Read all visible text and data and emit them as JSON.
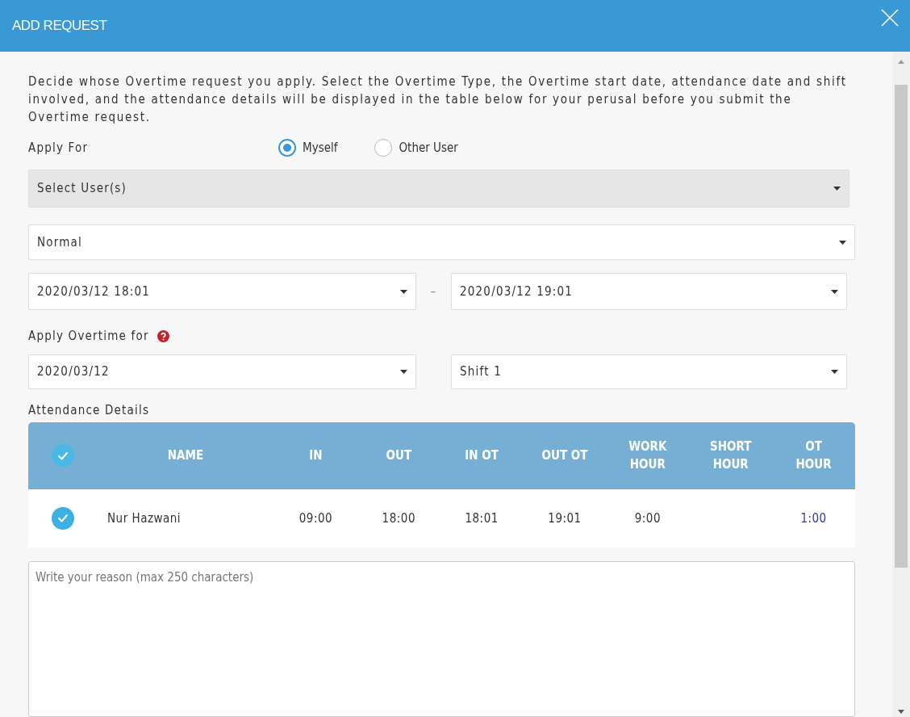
{
  "dialog": {
    "title": "ADD REQUEST"
  },
  "description": "Decide whose Overtime request you apply. Select the Overtime Type, the Overtime start date, attendance date and shift involved, and the attendance details will be displayed in the table below for your perusal before you submit the Overtime request.",
  "apply_for": {
    "label": "Apply For",
    "options": [
      {
        "label": "Myself",
        "selected": true
      },
      {
        "label": "Other User",
        "selected": false
      }
    ]
  },
  "user_select": {
    "placeholder": "Select User(s)",
    "disabled": true
  },
  "overtime_type": {
    "value": "Normal"
  },
  "date_range": {
    "start": "2020/03/12 18:01",
    "separator": "–",
    "end": "2020/03/12 19:01"
  },
  "apply_overtime_for": {
    "label": "Apply Overtime for",
    "attendance_date": "2020/03/12",
    "shift": "Shift 1"
  },
  "attendance": {
    "label": "Attendance Details",
    "all_checked": true,
    "columns": [
      "NAME",
      "IN",
      "OUT",
      "IN OT",
      "OUT OT",
      "WORK HOUR",
      "SHORT HOUR",
      "OT HOUR"
    ],
    "rows": [
      {
        "checked": true,
        "cells": [
          "Nur Hazwani",
          "09:00",
          "18:00",
          "18:01",
          "19:01",
          "9:00",
          "",
          "1:00"
        ]
      }
    ]
  },
  "reason": {
    "placeholder": "Write your reason (max 250 characters)"
  }
}
